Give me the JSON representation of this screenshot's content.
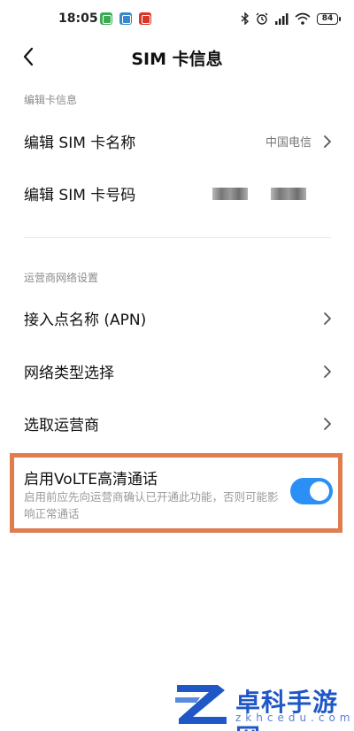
{
  "status_bar": {
    "time": "18:05",
    "battery": "84"
  },
  "header": {
    "title": "SIM 卡信息"
  },
  "sections": {
    "card_info": {
      "header": "编辑卡信息",
      "edit_name_label": "编辑 SIM 卡名称",
      "edit_name_value": "中国电信",
      "edit_number_label": "编辑 SIM 卡号码"
    },
    "carrier": {
      "header": "运营商网络设置",
      "apn_label": "接入点名称 (APN)",
      "network_type_label": "网络类型选择",
      "select_carrier_label": "选取运营商"
    }
  },
  "volte": {
    "title": "启用VoLTE高清通话",
    "description": "启用前应先向运营商确认已开通此功能，否则可能影响正常通话",
    "enabled": true
  },
  "watermark": {
    "name": "卓科手游网",
    "domain": "zkhcedu.com"
  },
  "colors": {
    "accent": "#2b8ff5",
    "highlight_border": "#df7d4f"
  }
}
